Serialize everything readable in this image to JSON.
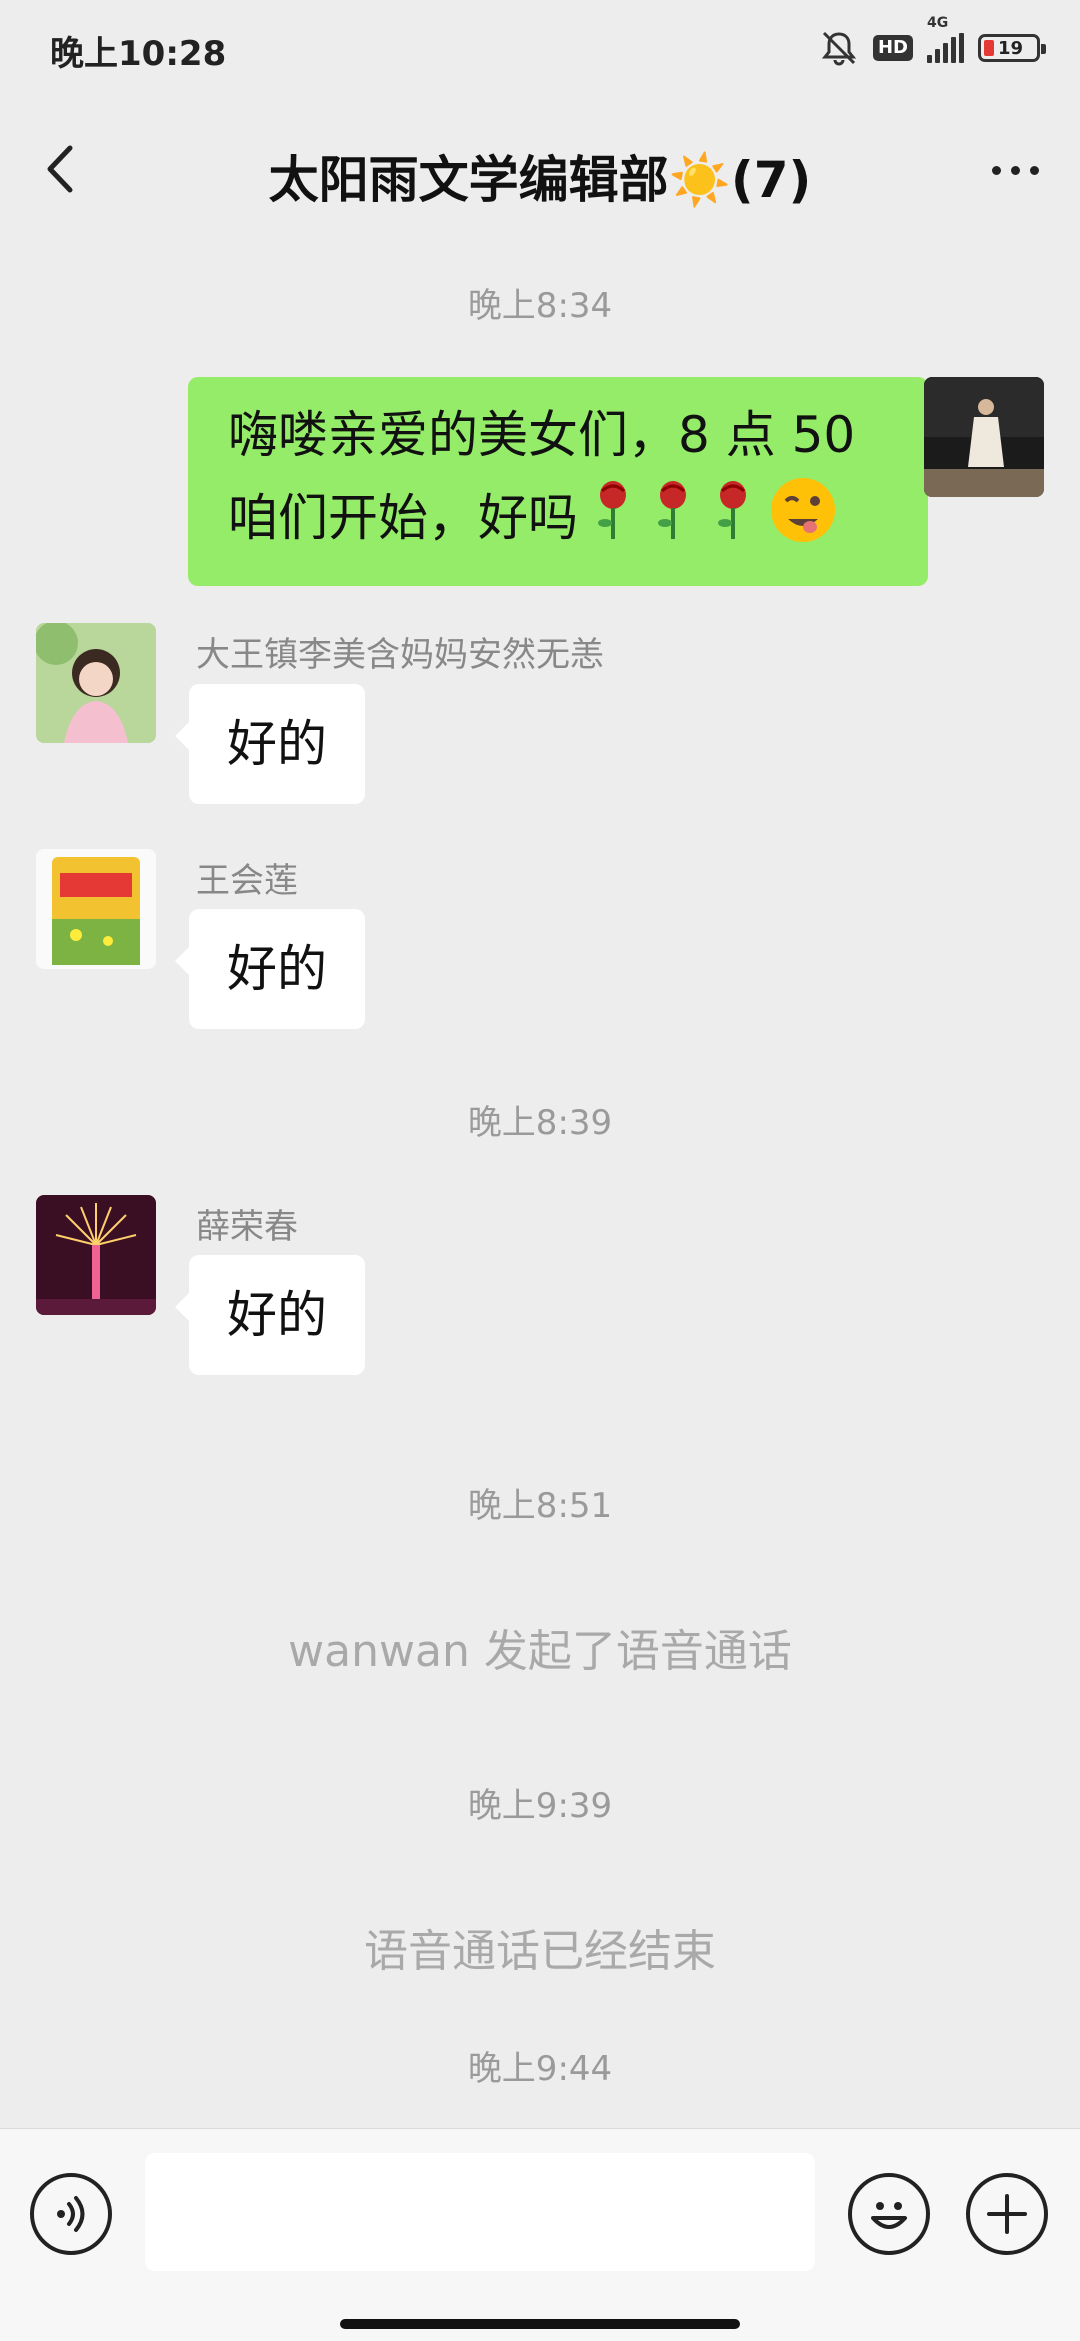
{
  "status_bar": {
    "time": "晚上10:28",
    "hd": "HD",
    "network": "4G",
    "battery": "19"
  },
  "header": {
    "title": "太阳雨文学编辑部☀️(7)"
  },
  "messages": {
    "time1": "晚上8:34",
    "msg1": "嗨喽亲爱的美女们，8 点 50 咱们开始，好吗",
    "msg2_sender": "大王镇李美含妈妈安然无恙",
    "msg2_text": "好的",
    "msg3_sender": "王会莲",
    "msg3_text": "好的",
    "time2": "晚上8:39",
    "msg4_sender": "薛荣春",
    "msg4_text": "好的",
    "time3": "晚上8:51",
    "sys1": "wanwan 发起了语音通话",
    "time4": "晚上9:39",
    "sys2": "语音通话已经结束",
    "time5": "晚上9:44"
  },
  "input_bar": {
    "placeholder": ""
  },
  "colors": {
    "background": "#ededed",
    "out_bubble": "#95ec69",
    "in_bubble": "#ffffff",
    "timestamp": "#9a9a9a"
  },
  "icons": [
    "mute-bell-icon",
    "hd-icon",
    "signal-icon",
    "battery-icon",
    "back-arrow-icon",
    "more-dots-icon",
    "voice-icon",
    "emoji-icon",
    "plus-icon",
    "rose-emoji",
    "wink-emoji"
  ]
}
